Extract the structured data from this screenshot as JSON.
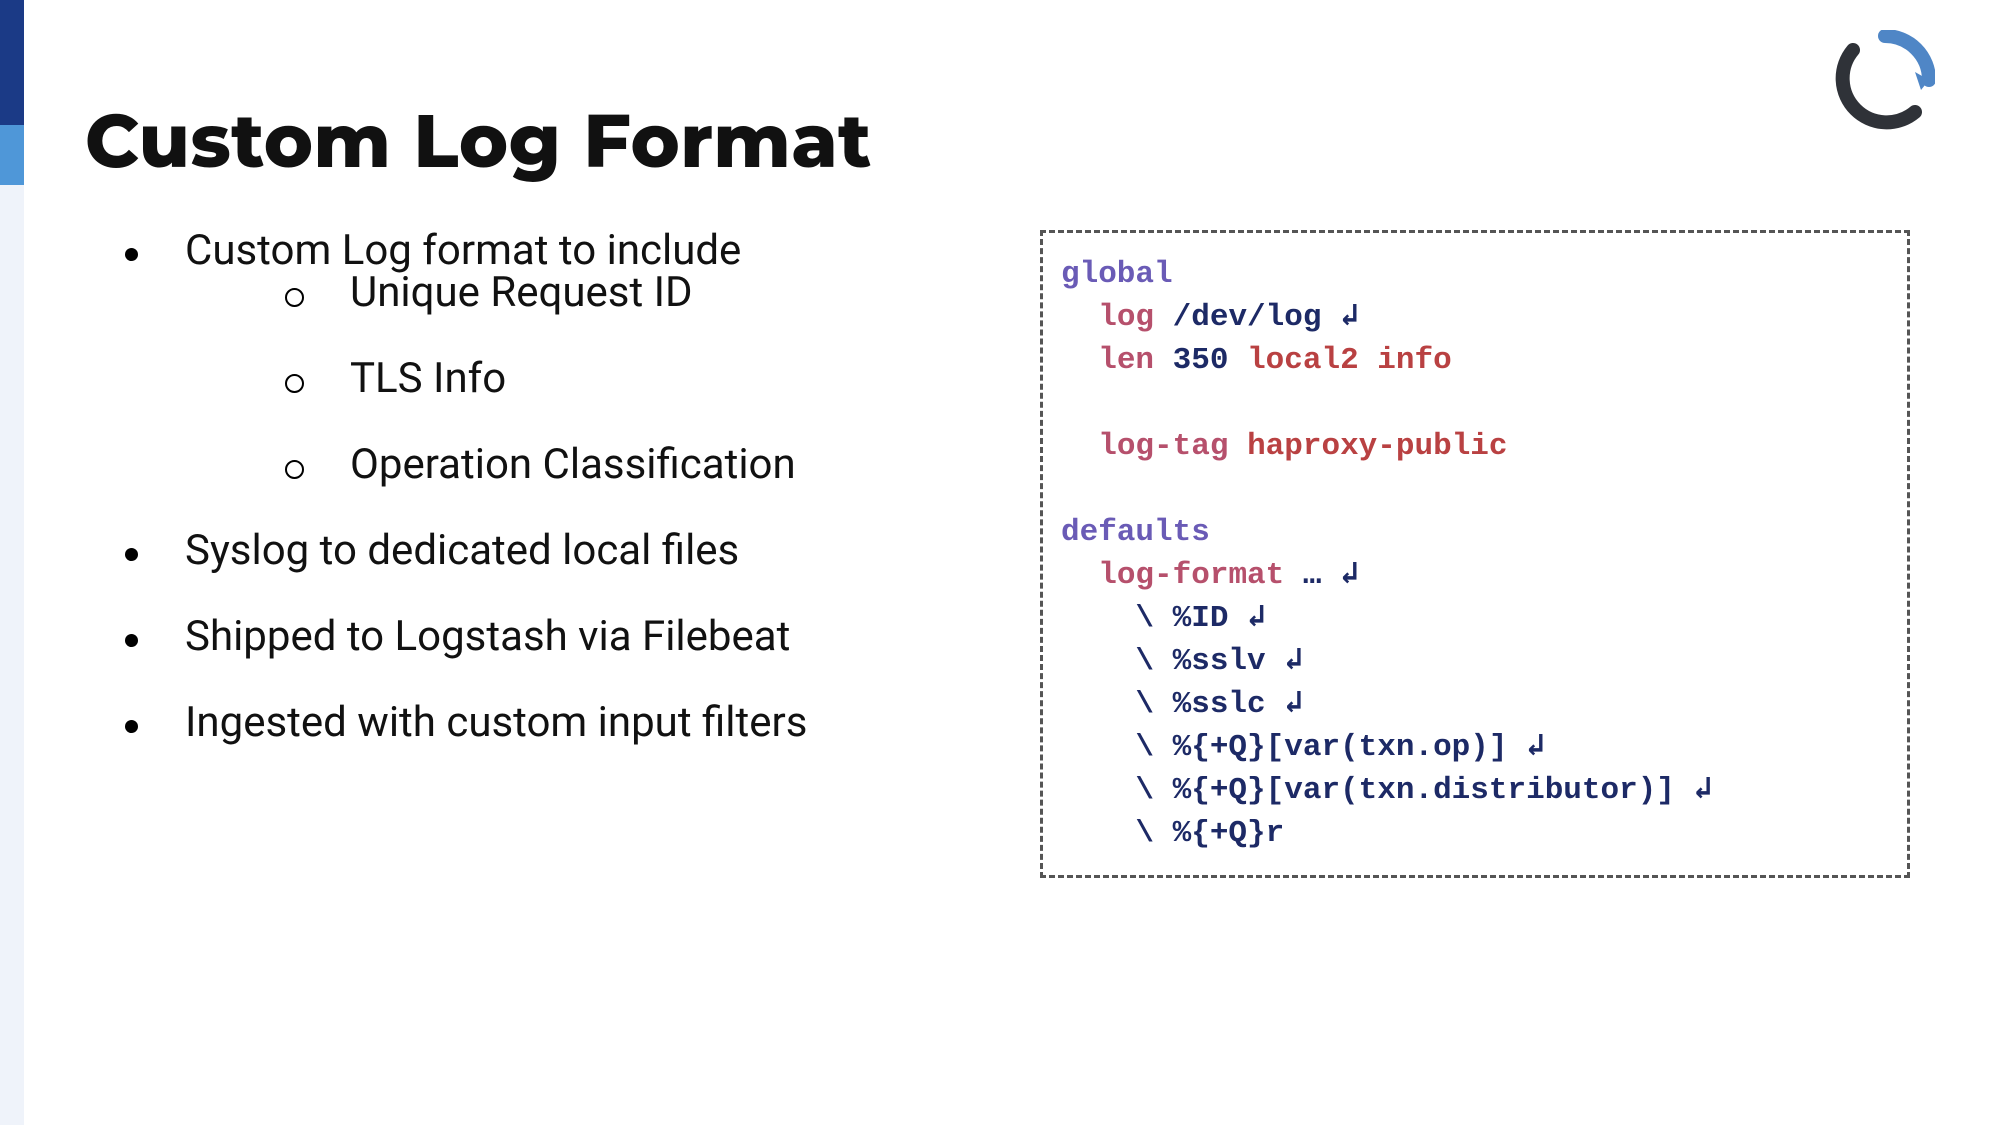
{
  "title": "Custom Log Format",
  "bullets": {
    "b1": "Custom Log format to include",
    "b1a": "Unique Request ID",
    "b1b": "TLS Info",
    "b1c": "Operation Classification",
    "b2": "Syslog to dedicated local files",
    "b3": "Shipped to Logstash via Filebeat",
    "b4": "Ingested with custom input filters"
  },
  "code": {
    "l1_kw": "global",
    "l2_dir": "log",
    "l2_path": "/dev/log",
    "l3_dir": "len",
    "l3_num": "350",
    "l3_val": "local2 info",
    "l4_dir": "log-tag",
    "l4_val": "haproxy-public",
    "l5_kw": "defaults",
    "l6_dir": "log-format",
    "l6_ell": "…",
    "l7": "\\ %ID",
    "l8": "\\ %sslv",
    "l9": "\\ %sslc",
    "l10": "\\ %{+Q}[var(txn.op)]",
    "l11": "\\ %{+Q}[var(txn.distributor)]",
    "l12": "\\ %{+Q}r",
    "wrap": "↲"
  }
}
